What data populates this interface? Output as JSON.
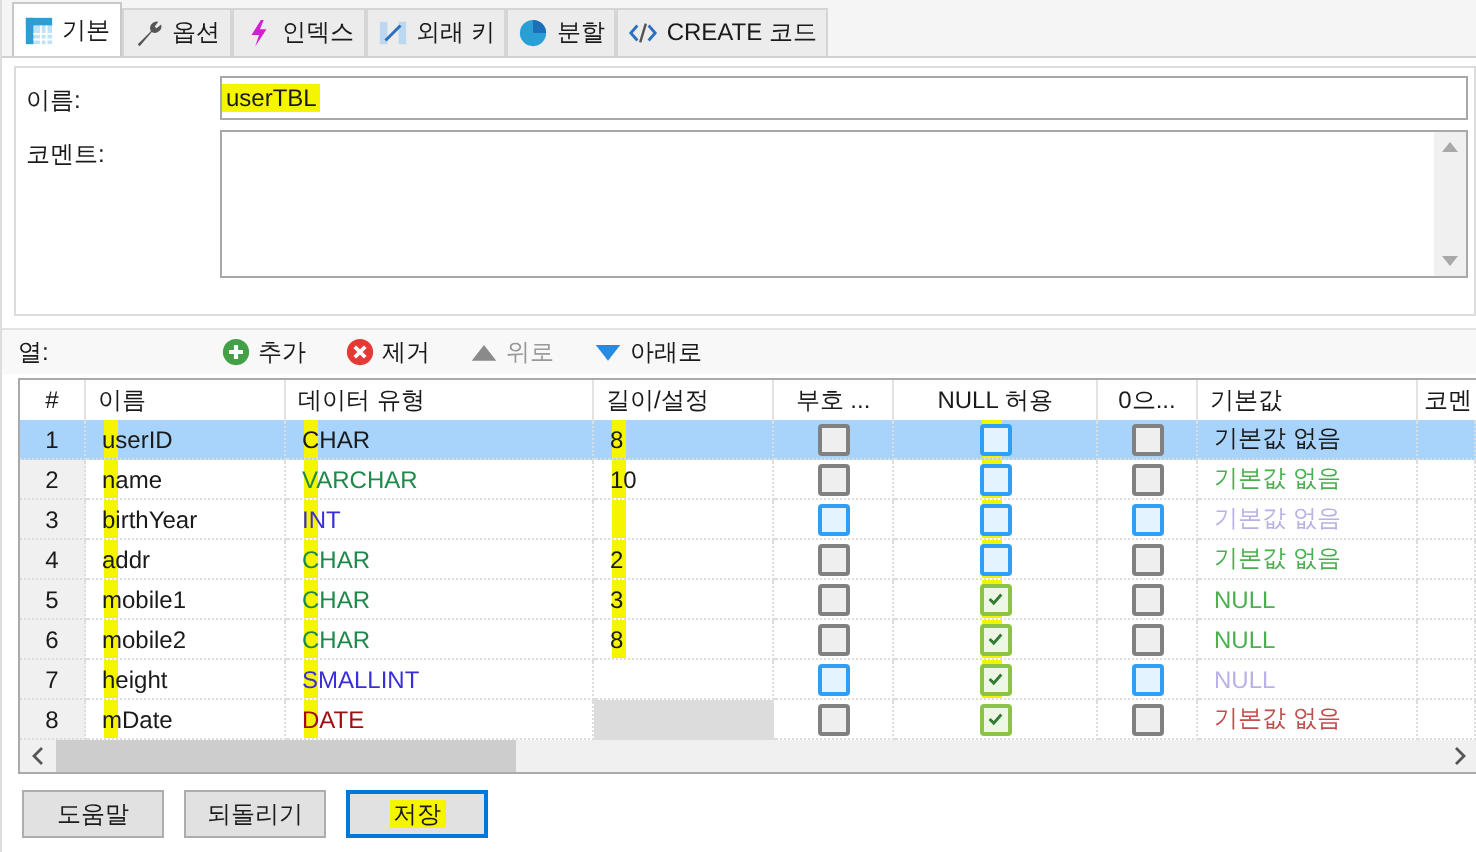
{
  "tabs": [
    {
      "label": "기본",
      "kind": "table",
      "selected": true
    },
    {
      "label": "옵션",
      "kind": "wrench",
      "selected": false
    },
    {
      "label": "인덱스",
      "kind": "bolt",
      "selected": false
    },
    {
      "label": "외래 키",
      "kind": "link",
      "selected": false
    },
    {
      "label": "분할",
      "kind": "pie",
      "selected": false
    },
    {
      "label": "CREATE 코드",
      "kind": "code",
      "selected": false
    }
  ],
  "name_field": {
    "label": "이름:",
    "value": "userTBL",
    "highlighted": true
  },
  "comment_field": {
    "label": "코멘트:"
  },
  "columns_toolbar": {
    "label": "열:",
    "actions": [
      {
        "label": "추가",
        "kind": "add",
        "disabled": false
      },
      {
        "label": "제거",
        "kind": "remove",
        "disabled": false
      },
      {
        "label": "위로",
        "kind": "up",
        "disabled": true
      },
      {
        "label": "아래로",
        "kind": "down",
        "disabled": false
      }
    ]
  },
  "table": {
    "columns": [
      "#",
      "이름",
      "데이터 유형",
      "길이/설정",
      "부호 ...",
      "NULL 허용",
      "0으...",
      "기본값",
      "코멘"
    ],
    "rows": [
      {
        "num": "1",
        "selected": true,
        "name": {
          "text": "userID",
          "highlighted": true
        },
        "type": {
          "text": "CHAR",
          "color": "#1a1a1a",
          "highlighted": true
        },
        "length": {
          "text": "8",
          "disabled": false,
          "highlighted": true
        },
        "unsigned": {
          "checked": false,
          "disabled": true
        },
        "nullable": {
          "checked": false,
          "highlighted": true
        },
        "zerofill": {
          "checked": false,
          "disabled": true
        },
        "default": {
          "text": "기본값 없음",
          "color": "#1a1a1a"
        }
      },
      {
        "num": "2",
        "selected": false,
        "name": {
          "text": "name",
          "highlighted": true
        },
        "type": {
          "text": "VARCHAR",
          "color": "#1d8a4a",
          "highlighted": true
        },
        "length": {
          "text": "10",
          "disabled": false,
          "highlighted": true
        },
        "unsigned": {
          "checked": false,
          "disabled": true
        },
        "nullable": {
          "checked": false,
          "highlighted": true
        },
        "zerofill": {
          "checked": false,
          "disabled": true
        },
        "default": {
          "text": "기본값 없음",
          "color": "#4caf50"
        }
      },
      {
        "num": "3",
        "selected": false,
        "name": {
          "text": "birthYear",
          "highlighted": true
        },
        "type": {
          "text": "INT",
          "color": "#3a2fd6",
          "highlighted": true
        },
        "length": {
          "disabled": false,
          "highlighted": true
        },
        "unsigned": {
          "checked": false,
          "disabled": false
        },
        "nullable": {
          "checked": false,
          "highlighted": true
        },
        "zerofill": {
          "checked": false,
          "disabled": false
        },
        "default": {
          "text": "기본값 없음",
          "color": "#b9b2e6"
        }
      },
      {
        "num": "4",
        "selected": false,
        "name": {
          "text": "addr",
          "highlighted": true
        },
        "type": {
          "text": "CHAR",
          "color": "#1d8a4a",
          "highlighted": true
        },
        "length": {
          "text": "2",
          "disabled": false,
          "highlighted": true
        },
        "unsigned": {
          "checked": false,
          "disabled": true
        },
        "nullable": {
          "checked": false,
          "highlighted": true
        },
        "zerofill": {
          "checked": false,
          "disabled": true
        },
        "default": {
          "text": "기본값 없음",
          "color": "#4caf50"
        }
      },
      {
        "num": "5",
        "selected": false,
        "name": {
          "text": "mobile1",
          "highlighted": true
        },
        "type": {
          "text": "CHAR",
          "color": "#1d8a4a",
          "highlighted": true
        },
        "length": {
          "text": "3",
          "disabled": false,
          "highlighted": true
        },
        "unsigned": {
          "checked": false,
          "disabled": true
        },
        "nullable": {
          "checked": true,
          "highlighted": true
        },
        "zerofill": {
          "checked": false,
          "disabled": true
        },
        "default": {
          "text": "NULL",
          "color": "#4caf50"
        }
      },
      {
        "num": "6",
        "selected": false,
        "name": {
          "text": "mobile2",
          "highlighted": true
        },
        "type": {
          "text": "CHAR",
          "color": "#1d8a4a",
          "highlighted": true
        },
        "length": {
          "text": "8",
          "disabled": false,
          "highlighted": true
        },
        "unsigned": {
          "checked": false,
          "disabled": true
        },
        "nullable": {
          "checked": true,
          "highlighted": true
        },
        "zerofill": {
          "checked": false,
          "disabled": true
        },
        "default": {
          "text": "NULL",
          "color": "#4caf50"
        }
      },
      {
        "num": "7",
        "selected": false,
        "name": {
          "text": "height",
          "highlighted": true
        },
        "type": {
          "text": "SMALLINT",
          "color": "#3a2fd6",
          "highlighted": true
        },
        "length": {
          "disabled": false
        },
        "unsigned": {
          "checked": false,
          "disabled": false
        },
        "nullable": {
          "checked": true,
          "highlighted": true
        },
        "zerofill": {
          "checked": false,
          "disabled": false
        },
        "default": {
          "text": "NULL",
          "color": "#b9b2e6"
        }
      },
      {
        "num": "8",
        "selected": false,
        "name": {
          "text": "mDate",
          "highlighted": true
        },
        "type": {
          "text": "DATE",
          "color": "#a01010",
          "highlighted": true
        },
        "length": {
          "disabled": true
        },
        "unsigned": {
          "checked": false,
          "disabled": true
        },
        "nullable": {
          "checked": true
        },
        "zerofill": {
          "checked": false,
          "disabled": true
        },
        "default": {
          "text": "기본값 없음",
          "color": "#c0504d"
        }
      }
    ]
  },
  "buttons": [
    {
      "label": "도움말",
      "focused": false,
      "highlighted": false
    },
    {
      "label": "되돌리기",
      "focused": false,
      "highlighted": false
    },
    {
      "label": "저장",
      "focused": true,
      "highlighted": true
    }
  ]
}
